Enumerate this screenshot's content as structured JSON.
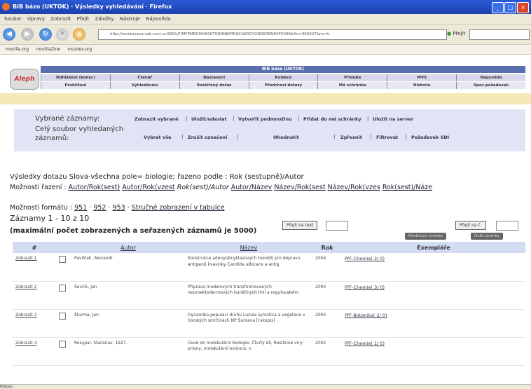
{
  "window": {
    "title": "BIB bázo (UKTOK) · Výsledky vyhledávání · Firefox"
  },
  "menu": [
    "Soubor",
    "Úpravy",
    "Zobrazit",
    "Přejít",
    "Záložky",
    "Nástroje",
    "Nápověda"
  ],
  "nav": {
    "url": "http://montesana.nzk.cuni.cz:8991/F/MFPMEDIKHKS0TQ9NNEATKQCA6RGYGBOKR8NR0F0009&fin=000327&nc=h",
    "go_label": "Přejít"
  },
  "bookmarks": [
    "mozilla.org",
    "mozillaZine",
    "mozdev.org"
  ],
  "header": {
    "logo": "Aleph",
    "banner": "BIB báze (UKTOK)",
    "row1": [
      "Odhlášení (konec)",
      "Čtenář",
      "Nastavení",
      "Kolekce",
      "Přidejte",
      "MVS",
      "Nápověda"
    ],
    "row2": [
      "Prohlížení",
      "Vyhledávání",
      "Rozšířený dotaz",
      "Předchozí dotazy",
      "Má schránka",
      "Historie",
      "Spec.požadavek"
    ]
  },
  "actions": {
    "selected_label": "Vybrané záznamy:",
    "all_label": "Celý soubor vyhledaných záznamů:",
    "row1": [
      "Zobrazit vybrané",
      "Uložit/odeslat",
      "Vytvořit podmnožinu",
      "Přidat do mé schránky",
      "Uložit na server"
    ],
    "row2": [
      "Vybrat vše",
      "Zrušit označení",
      "Ohodnotit",
      "Zpřesnit",
      "Filtrovat",
      "Požadavek SDI"
    ]
  },
  "results": {
    "title": "Výsledky dotazu Slova-všechna pole= biologie; řazeno podle : Rok (sestupně)/Autor",
    "sort_prefix": "Možnosti řazení : ",
    "sort_options": [
      "Autor/Rok(sest)",
      "Autor/Rok(vzest",
      "Rok(sest)/Autor",
      "Autor/Název",
      "Název/Rok(sest",
      "Název/Rok(vzes",
      "Rok(sest)/Náze"
    ],
    "format_prefix": "Možnosti formátu :",
    "formats": [
      "951",
      "952",
      "953",
      "Stručné zobrazení v tabulce"
    ],
    "records": "Záznamy 1 - 10 z 10",
    "max_info": "(maximální počet zobrazených a seřazených záznamů je 5000)",
    "goto_text_btn": "Přejít na text",
    "goto_btn": "Přejít na č.",
    "prev_page": "Předchozí stránka",
    "next_page": "Další stránka"
  },
  "table": {
    "headers": [
      "#",
      "",
      "Autor",
      "Název",
      "Rok",
      "Exempláře"
    ],
    "rows": [
      {
        "show": "Zobrazit 1",
        "author": "Pavlíček, Alexandr",
        "title": "Konstrukce adenylátcyklasových toxoidů pro dopravu antigenů kvasinky Candida albicans a antig",
        "year": "2004",
        "copies": "PřF-Chemie( 2/ 0)"
      },
      {
        "show": "Zobrazit 2",
        "author": "Ševčík, Jan",
        "title": "Příprava modelových transformovaných neuroektodermových buněčných linií a regulovatelrn",
        "year": "2004",
        "copies": "PřF-Chemie( 3/ 0)"
      },
      {
        "show": "Zobrazit 3",
        "author": "Šturma, Jan",
        "title": "Dynamika populací druhu Luzula sylvatica a vegetace v horských smrčinách NP Šumava [rukopis]",
        "year": "2004",
        "copies": "PřF-Botanika( 2/ 0)"
      },
      {
        "show": "Zobrazit 4",
        "author": "Rosypal, Stanislav, 1927-",
        "title": "Úvod do molekulární biologie. Čtvrtý díl, Rostlinné viry; priony, molekulární evoluce, v",
        "year": "2002",
        "copies": "PřF-Chemie( 1/ 0)"
      }
    ]
  },
  "status": {
    "text": "Hotovo"
  }
}
